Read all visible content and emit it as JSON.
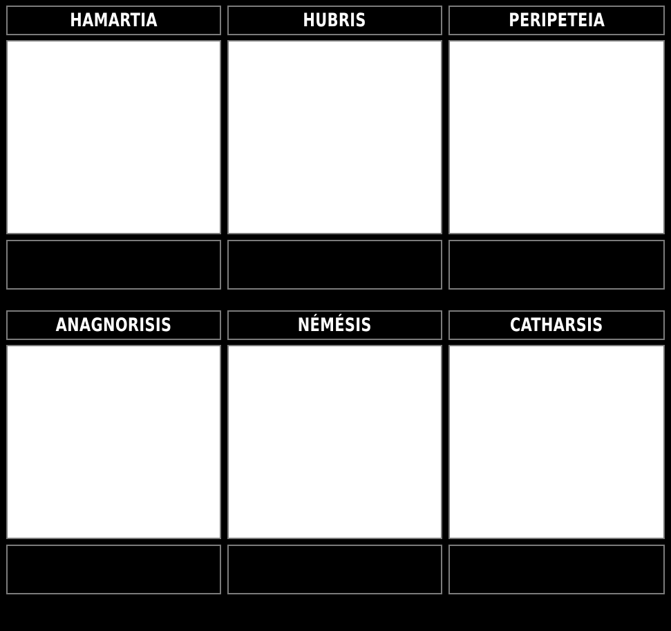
{
  "storyboard": {
    "background_color": "#000000",
    "border_color": "#7b7b7b",
    "panel_color": "#ffffff",
    "title_text_color": "#ffffff",
    "rows": [
      {
        "cells": [
          {
            "title": "HAMARTIA",
            "caption": "",
            "panel_content": ""
          },
          {
            "title": "HUBRIS",
            "caption": "",
            "panel_content": ""
          },
          {
            "title": "PERIPETEIA",
            "caption": "",
            "panel_content": ""
          }
        ]
      },
      {
        "cells": [
          {
            "title": "ANAGNORISIS",
            "caption": "",
            "panel_content": ""
          },
          {
            "title": "NÉMÉSIS",
            "caption": "",
            "panel_content": ""
          },
          {
            "title": "CATHARSIS",
            "caption": "",
            "panel_content": ""
          }
        ]
      }
    ]
  }
}
